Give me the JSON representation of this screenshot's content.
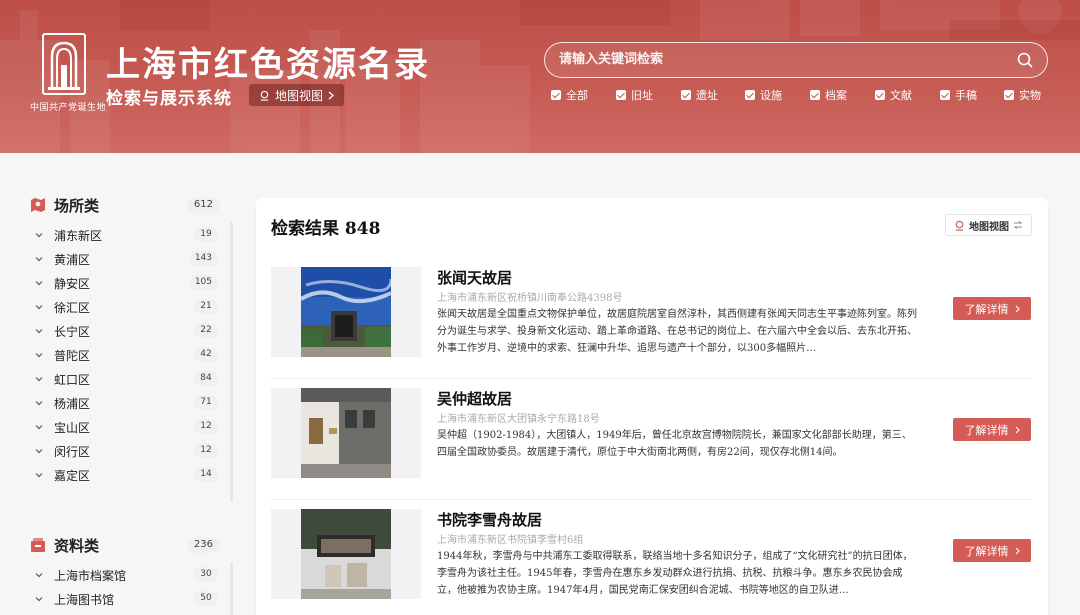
{
  "header": {
    "logo_caption": "中国共产党诞生地",
    "title": "上海市红色资源名录",
    "subtitle": "检索与展示系统",
    "map_view_label": "地图视图",
    "search_placeholder": "请输入关键词检索",
    "filters": [
      {
        "label": "全部",
        "checked": true
      },
      {
        "label": "旧址",
        "checked": true
      },
      {
        "label": "遗址",
        "checked": true
      },
      {
        "label": "设施",
        "checked": true
      },
      {
        "label": "档案",
        "checked": true
      },
      {
        "label": "文献",
        "checked": true
      },
      {
        "label": "手稿",
        "checked": true
      },
      {
        "label": "实物",
        "checked": true
      }
    ]
  },
  "sidebar": {
    "categories": [
      {
        "title": "场所类",
        "count": "612",
        "icon": "map-pin-icon",
        "items": [
          {
            "label": "浦东新区",
            "count": "19"
          },
          {
            "label": "黄浦区",
            "count": "143"
          },
          {
            "label": "静安区",
            "count": "105"
          },
          {
            "label": "徐汇区",
            "count": "21"
          },
          {
            "label": "长宁区",
            "count": "22"
          },
          {
            "label": "普陀区",
            "count": "42"
          },
          {
            "label": "虹口区",
            "count": "84"
          },
          {
            "label": "杨浦区",
            "count": "71"
          },
          {
            "label": "宝山区",
            "count": "12"
          },
          {
            "label": "闵行区",
            "count": "12"
          },
          {
            "label": "嘉定区",
            "count": "14"
          }
        ]
      },
      {
        "title": "资料类",
        "count": "236",
        "icon": "archive-icon",
        "items": [
          {
            "label": "上海市档案馆",
            "count": "30"
          },
          {
            "label": "上海图书馆",
            "count": "50"
          }
        ]
      }
    ]
  },
  "main": {
    "results_label": "检索结果 848",
    "map_view_label": "地图视图",
    "detail_label": "了解详情",
    "results": [
      {
        "title": "张闻天故居",
        "address": "上海市浦东新区祝桥镇川南奉公路4398号",
        "description": "张闻天故居是全国重点文物保护单位，故居庭院居室自然淳朴，其西侧建有张闻天同志生平事迹陈列室。陈列分为诞生与求学、投身新文化运动、踏上革命道路、在总书记的岗位上、在六届六中全会以后、去东北开拓、外事工作岁月、逆境中的求索、狂澜中升华、追思与遗产十个部分，以300多幅照片…"
      },
      {
        "title": "吴仲超故居",
        "address": "上海市浦东新区大团镇永宁东路18号",
        "description": "吴仲超（1902-1984），大团镇人，1949年后，曾任北京故宫博物院院长，兼国家文化部部长助理，第三、四届全国政协委员。故居建于清代，原位于中大街南北两侧，有房22间，现仅存北侧14间。"
      },
      {
        "title": "书院李雪舟故居",
        "address": "上海市浦东新区书院镇李雪村6组",
        "description": "1944年秋，李雪舟与中共浦东工委取得联系，联络当地十多名知识分子，组成了“文化研究社”的抗日团体，李雪舟为该社主任。1945年春，李雪舟在惠东乡发动群众进行抗捐、抗税、抗粮斗争。惠东乡农民协会成立，他被推为农协主席。1947年4月，国民党南汇保安团纠合泥城、书院等地区的自卫队进…"
      }
    ]
  },
  "colors": {
    "brand_red": "#c0554f",
    "button_red": "#d55c56"
  }
}
